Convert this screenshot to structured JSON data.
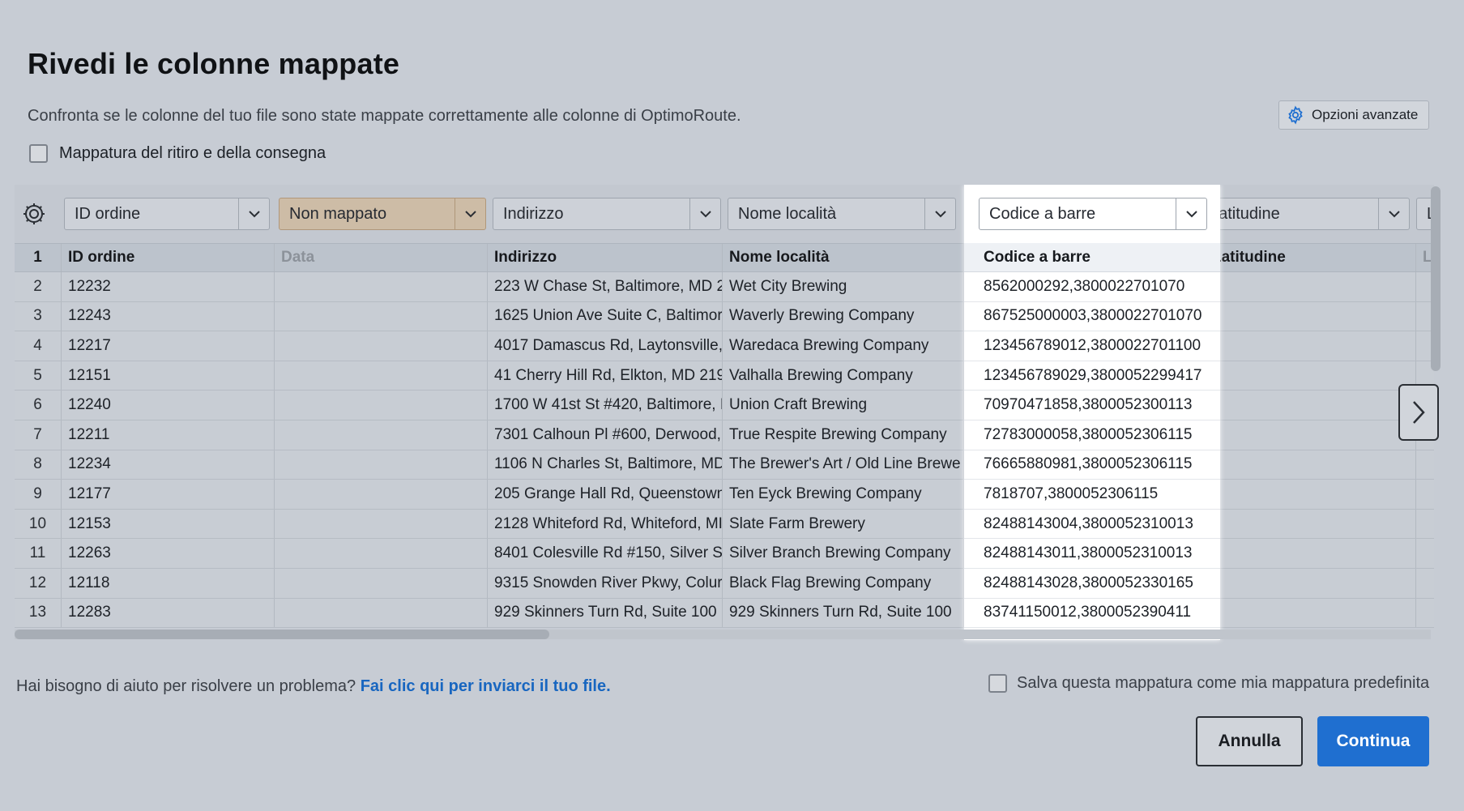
{
  "page": {
    "title": "Rivedi le colonne mappate",
    "subtitle": "Confronta se le colonne del tuo file sono state mappate correttamente alle colonne di OptimoRoute.",
    "advanced_options": "Opzioni avanzate",
    "pickup_delivery_label": "Mappatura del ritiro e della consegna"
  },
  "columns": {
    "selects": [
      "ID ordine",
      "Non mappato",
      "Indirizzo",
      "Nome località",
      "Codice a barre",
      "Latitudine",
      "L"
    ],
    "headers": [
      "ID ordine",
      "Data",
      "Indirizzo",
      "Nome località",
      "Codice a barre",
      "Latitudine",
      "L"
    ],
    "header_rownum": "1"
  },
  "rows": [
    {
      "n": "2",
      "id": "12232",
      "data": "",
      "address": "223 W Chase St, Baltimore, MD 2",
      "location": "Wet City Brewing",
      "barcode": "8562000292,3800022701070"
    },
    {
      "n": "3",
      "id": "12243",
      "data": "",
      "address": "1625 Union Ave Suite C, Baltimor",
      "location": "Waverly Brewing Company",
      "barcode": "867525000003,3800022701070"
    },
    {
      "n": "4",
      "id": "12217",
      "data": "",
      "address": "4017 Damascus Rd, Laytonsville,",
      "location": "Waredaca Brewing Company",
      "barcode": "123456789012,3800022701100"
    },
    {
      "n": "5",
      "id": "12151",
      "data": "",
      "address": "41 Cherry Hill Rd, Elkton, MD 219",
      "location": "Valhalla Brewing Company",
      "barcode": "123456789029,3800052299417"
    },
    {
      "n": "6",
      "id": "12240",
      "data": "",
      "address": "1700 W 41st St #420, Baltimore, I",
      "location": "Union Craft Brewing",
      "barcode": "70970471858,3800052300113"
    },
    {
      "n": "7",
      "id": "12211",
      "data": "",
      "address": "7301 Calhoun Pl #600, Derwood,",
      "location": "True Respite Brewing Company",
      "barcode": "72783000058,3800052306115"
    },
    {
      "n": "8",
      "id": "12234",
      "data": "",
      "address": "1106 N Charles St, Baltimore, MD",
      "location": "The Brewer's Art / Old Line Brewe",
      "barcode": "76665880981,3800052306115"
    },
    {
      "n": "9",
      "id": "12177",
      "data": "",
      "address": "205 Grange Hall Rd, Queenstown",
      "location": "Ten Eyck Brewing Company",
      "barcode": "7818707,3800052306115"
    },
    {
      "n": "10",
      "id": "12153",
      "data": "",
      "address": "2128 Whiteford Rd, Whiteford, MI",
      "location": "Slate Farm Brewery",
      "barcode": "82488143004,3800052310013"
    },
    {
      "n": "11",
      "id": "12263",
      "data": "",
      "address": "8401 Colesville Rd #150, Silver S",
      "location": "Silver Branch Brewing Company",
      "barcode": "82488143011,3800052310013"
    },
    {
      "n": "12",
      "id": "12118",
      "data": "",
      "address": "9315 Snowden River Pkwy, Colur",
      "location": "Black Flag Brewing Company",
      "barcode": "82488143028,3800052330165"
    },
    {
      "n": "13",
      "id": "12283",
      "data": "",
      "address": "929 Skinners Turn Rd, Suite 100",
      "location": "929 Skinners Turn Rd, Suite 100",
      "barcode": "83741150012,3800052390411"
    }
  ],
  "footer": {
    "help_text": "Hai bisogno di aiuto per risolvere un problema?",
    "help_link": "Fai clic qui per inviarci il tuo file.",
    "save_default_label": "Salva questa mappatura come mia mappatura predefinita",
    "cancel": "Annulla",
    "continue": "Continua"
  },
  "colors": {
    "accent": "#1f6fd0",
    "link": "#1866c0",
    "unmapped": "#cdbca6"
  },
  "icons": {
    "advanced": "gear-icon",
    "settings_column": "gear-icon",
    "dropdown": "chevron-down-icon",
    "next": "chevron-right-icon"
  }
}
